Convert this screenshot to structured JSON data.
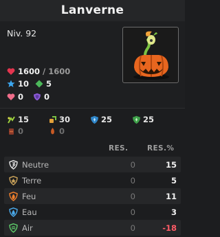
{
  "header": {
    "title": "Lanverne"
  },
  "level": "Niv. 92",
  "stats": {
    "hp_current": "1600",
    "hp_max": "/ 1600",
    "ap": "10",
    "mp": "5",
    "heal": "0",
    "shield": "0"
  },
  "secondary": {
    "row1": [
      "15",
      "30",
      "25",
      "25"
    ],
    "row2": [
      "0",
      "0"
    ]
  },
  "resistances": {
    "col_res": "RES.",
    "col_pct": "RES.%",
    "rows": [
      {
        "name": "Neutre",
        "res": "0",
        "pct": "15"
      },
      {
        "name": "Terre",
        "res": "0",
        "pct": "5"
      },
      {
        "name": "Feu",
        "res": "0",
        "pct": "11"
      },
      {
        "name": "Eau",
        "res": "0",
        "pct": "3"
      },
      {
        "name": "Air",
        "res": "0",
        "pct": "-18"
      }
    ]
  },
  "colors": {
    "accent_negative": "#ff5b66",
    "neutral": "#d9d9d9",
    "earth": "#c9a25a",
    "fire": "#f07f2c",
    "water": "#4aa8e8",
    "air": "#5ecb6a"
  },
  "icons": [
    "heart-icon",
    "star-icon",
    "diamond-icon",
    "heal-heart-icon",
    "shield-icon",
    "summon-icon",
    "push-icon",
    "crit-shield-icon",
    "range-shield-icon",
    "element-neutral-icon",
    "element-earth-icon",
    "element-fire-icon",
    "element-water-icon",
    "element-air-icon"
  ]
}
